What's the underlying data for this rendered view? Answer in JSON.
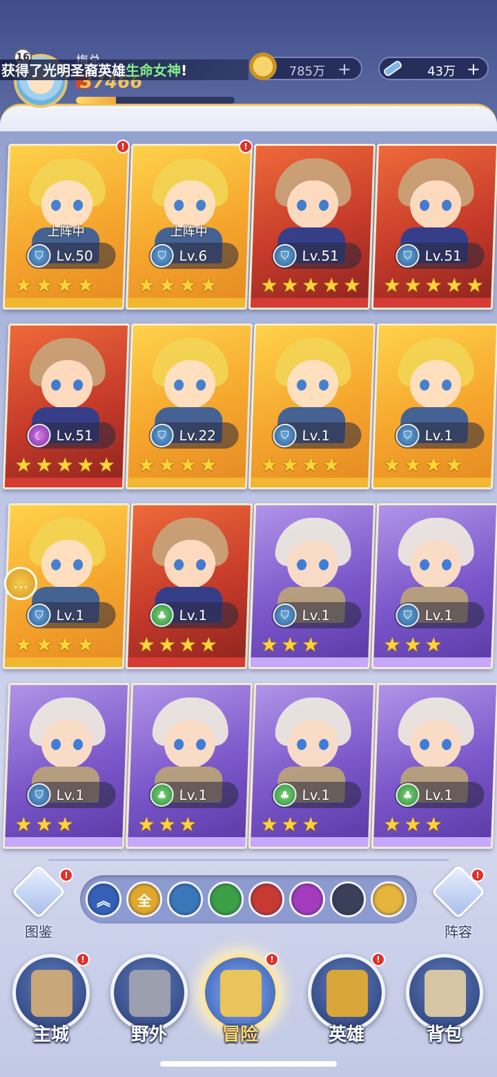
{
  "header": {
    "player_level": "16",
    "player_name": "梅总",
    "power": "37466",
    "exp_progress": 0.25,
    "announcement_prefix": "获得了光明圣裔英雄",
    "announcement_highlight": "生命女神",
    "announcement_suffix": "!",
    "gold": {
      "value": "785万",
      "plus": "+"
    },
    "diamond": {
      "value": "43万",
      "plus": "+"
    }
  },
  "heroes": [
    {
      "frame": "gold",
      "element": "warrior",
      "level": "Lv.50",
      "stars": 4,
      "deployed": true,
      "alert": true
    },
    {
      "frame": "gold",
      "element": "warrior",
      "level": "Lv.6",
      "stars": 4,
      "deployed": true,
      "alert": true
    },
    {
      "frame": "red",
      "element": "warrior",
      "level": "Lv.51",
      "stars": 5,
      "deployed": false,
      "alert": false
    },
    {
      "frame": "red",
      "element": "warrior",
      "level": "Lv.51",
      "stars": 5,
      "deployed": false,
      "alert": false
    },
    {
      "frame": "red",
      "element": "shadow",
      "level": "Lv.51",
      "stars": 5,
      "deployed": false,
      "alert": false
    },
    {
      "frame": "gold",
      "element": "warrior",
      "level": "Lv.22",
      "stars": 4,
      "deployed": false,
      "alert": false
    },
    {
      "frame": "gold",
      "element": "warrior",
      "level": "Lv.1",
      "stars": 4,
      "deployed": false,
      "alert": false
    },
    {
      "frame": "gold",
      "element": "warrior",
      "level": "Lv.1",
      "stars": 4,
      "deployed": false,
      "alert": false
    },
    {
      "frame": "gold",
      "element": "warrior",
      "level": "Lv.1",
      "stars": 4,
      "deployed": false,
      "alert": false
    },
    {
      "frame": "red",
      "element": "nature",
      "level": "Lv.1",
      "stars": 4,
      "deployed": false,
      "alert": false
    },
    {
      "frame": "purple",
      "element": "warrior",
      "level": "Lv.1",
      "stars": 3,
      "deployed": false,
      "alert": false
    },
    {
      "frame": "purple",
      "element": "warrior",
      "level": "Lv.1",
      "stars": 3,
      "deployed": false,
      "alert": false
    },
    {
      "frame": "purple",
      "element": "warrior",
      "level": "Lv.1",
      "stars": 3,
      "deployed": false,
      "alert": false
    },
    {
      "frame": "purple",
      "element": "nature",
      "level": "Lv.1",
      "stars": 3,
      "deployed": false,
      "alert": false
    },
    {
      "frame": "purple",
      "element": "nature",
      "level": "Lv.1",
      "stars": 3,
      "deployed": false,
      "alert": false
    },
    {
      "frame": "purple",
      "element": "nature",
      "level": "Lv.1",
      "stars": 3,
      "deployed": false,
      "alert": false
    }
  ],
  "deployed_label": "上阵中",
  "filters": {
    "side_left_label": "图鉴",
    "side_right_label": "阵容",
    "buttons": [
      {
        "name": "collapse",
        "glyph": "︽",
        "color": "#3460b8"
      },
      {
        "name": "all",
        "glyph": "全",
        "color": "#e0a82a"
      },
      {
        "name": "warrior",
        "glyph": "",
        "color": "#3a77b8"
      },
      {
        "name": "nature",
        "glyph": "",
        "color": "#3a9f45"
      },
      {
        "name": "fire",
        "glyph": "",
        "color": "#c73a33"
      },
      {
        "name": "shadow",
        "glyph": "",
        "color": "#a43bbd"
      },
      {
        "name": "dark",
        "glyph": "",
        "color": "#3a3f5a"
      },
      {
        "name": "light",
        "glyph": "",
        "color": "#e6b53b"
      }
    ]
  },
  "nav": {
    "items": [
      {
        "id": "main-city",
        "label": "主城",
        "alert": true,
        "active": false,
        "color": "#c8a77a"
      },
      {
        "id": "wild",
        "label": "野外",
        "alert": false,
        "active": false,
        "color": "#9b9fae"
      },
      {
        "id": "adventure",
        "label": "冒险",
        "alert": true,
        "active": true,
        "color": "#e9c45a"
      },
      {
        "id": "heroes",
        "label": "英雄",
        "alert": true,
        "active": false,
        "color": "#d9a63a"
      },
      {
        "id": "bag",
        "label": "背包",
        "alert": false,
        "active": false,
        "color": "#d6c6a4"
      }
    ]
  }
}
